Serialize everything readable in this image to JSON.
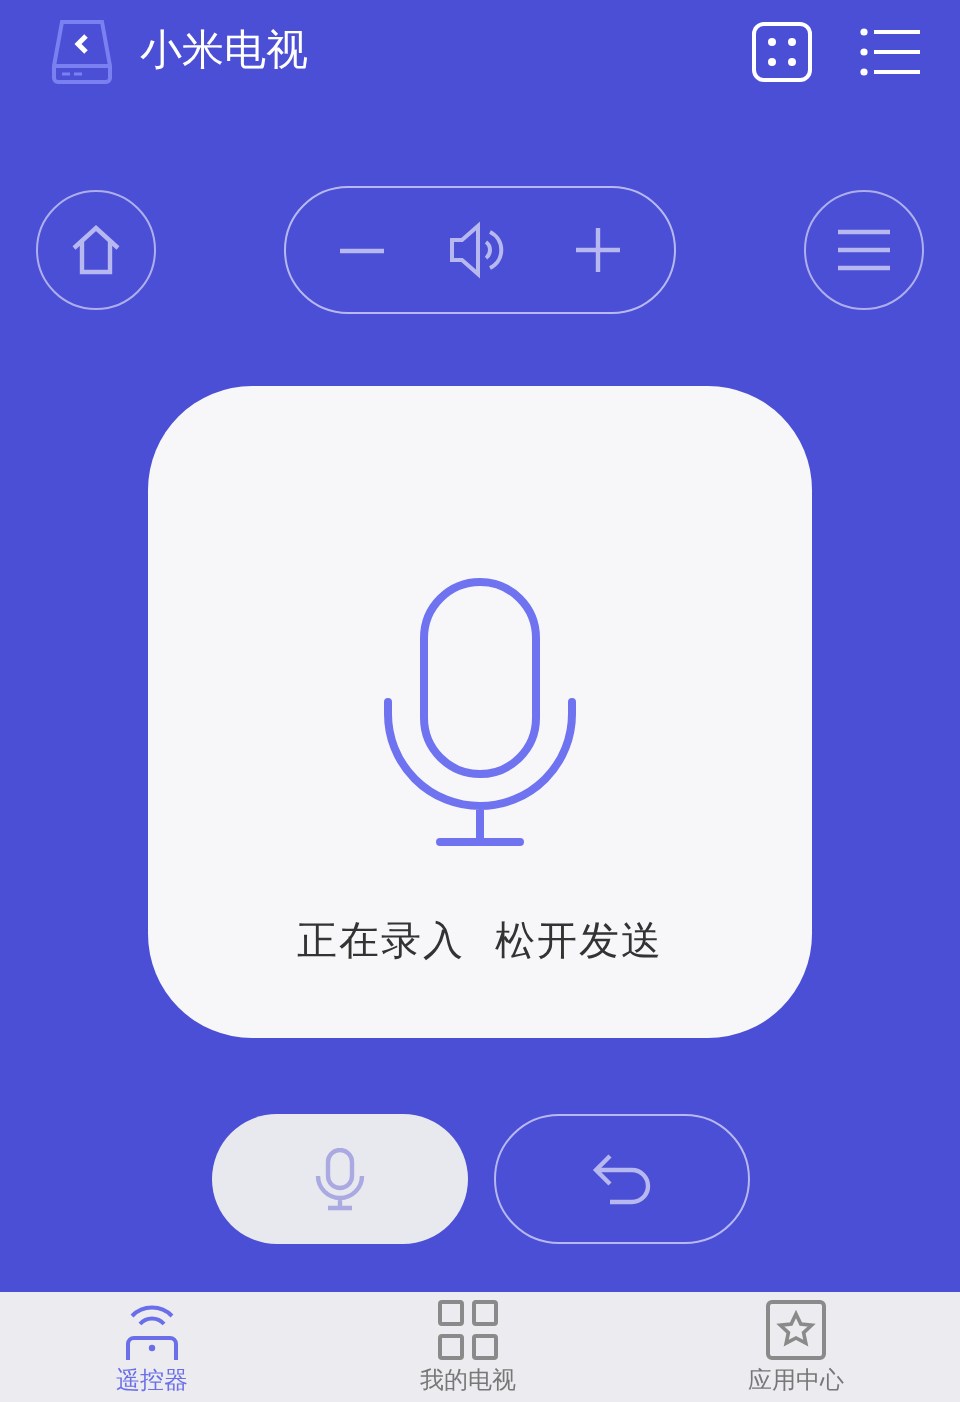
{
  "header": {
    "title": "小米电视"
  },
  "voice_panel": {
    "prompt": "正在录入  松开发送"
  },
  "bottom_buttons": [
    {
      "kind": "mic",
      "pressed": true
    },
    {
      "kind": "back",
      "pressed": false
    }
  ],
  "tabs": [
    {
      "kind": "remote",
      "label": "遥控器",
      "selected": true
    },
    {
      "kind": "grid",
      "label": "我的电视",
      "selected": false
    },
    {
      "kind": "star",
      "label": "应用中心",
      "selected": false
    }
  ]
}
